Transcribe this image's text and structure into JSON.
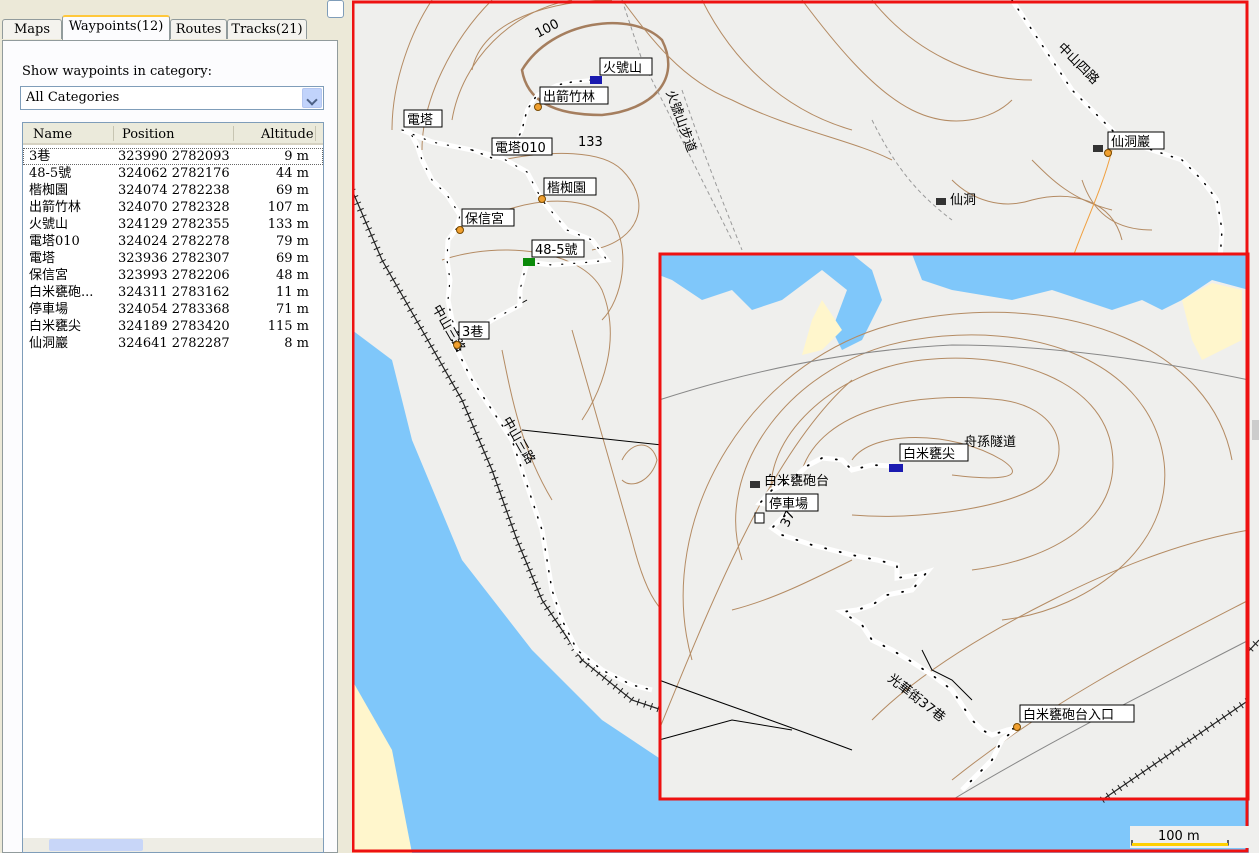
{
  "tabs": [
    {
      "label": "Maps"
    },
    {
      "label": "Waypoints(12)"
    },
    {
      "label": "Routes"
    },
    {
      "label": "Tracks(21)"
    }
  ],
  "filter": {
    "label": "Show waypoints in category:",
    "selected": "All Categories"
  },
  "list": {
    "columns": {
      "name": "Name",
      "position": "Position",
      "altitude": "Altitude"
    },
    "rows": [
      {
        "name": "3巷",
        "position": "323990 2782093",
        "altitude": "9 m"
      },
      {
        "name": "48-5號",
        "position": "324062 2782176",
        "altitude": "44 m"
      },
      {
        "name": "楷椥園",
        "position": "324074 2782238",
        "altitude": "69 m"
      },
      {
        "name": "出箭竹林",
        "position": "324070 2782328",
        "altitude": "107 m"
      },
      {
        "name": "火號山",
        "position": "324129 2782355",
        "altitude": "133 m"
      },
      {
        "name": "電塔010",
        "position": "324024 2782278",
        "altitude": "79 m"
      },
      {
        "name": "電塔",
        "position": "323936 2782307",
        "altitude": "69 m"
      },
      {
        "name": "保信宮",
        "position": "323993 2782206",
        "altitude": "48 m"
      },
      {
        "name": "白米甕砲...",
        "position": "324311 2783162",
        "altitude": "11 m"
      },
      {
        "name": "停車場",
        "position": "324054 2783368",
        "altitude": "71 m"
      },
      {
        "name": "白米甕尖",
        "position": "324189 2783420",
        "altitude": "115 m"
      },
      {
        "name": "仙洞巖",
        "position": "324641 2782287",
        "altitude": "8 m"
      }
    ]
  },
  "map": {
    "contour_label": "100",
    "spot_height": "133",
    "road_zhongshan4": "中山四路",
    "road_zhongshan3": "中山三路",
    "road_zhongshan3_short": "中山三路",
    "trail": "火號山步道",
    "cave_small": "仙洞",
    "tunnel": "舟孫隧道",
    "battery_small": "白米甕砲台",
    "lane37": "光華街37巷",
    "lane37_short": "37巷",
    "waypoint_labels": {
      "huohao": "火號山",
      "chujian": "出箭竹林",
      "tower": "電塔",
      "tower010": "電塔010",
      "kaizhi": "楷椥園",
      "baoxin": "保信宮",
      "no48": "48-5號",
      "lane3": "3巷",
      "xiandong": "仙洞巖",
      "baimi_peak": "白米甕尖",
      "parking": "停車場",
      "battery_entrance": "白米甕砲台入口"
    },
    "scale": "100 m",
    "colors": {
      "land": "#efefed",
      "sea": "#7fc7fa",
      "contour": "#b48b63",
      "inset_border": "#ee1111",
      "track": "#000000"
    }
  }
}
